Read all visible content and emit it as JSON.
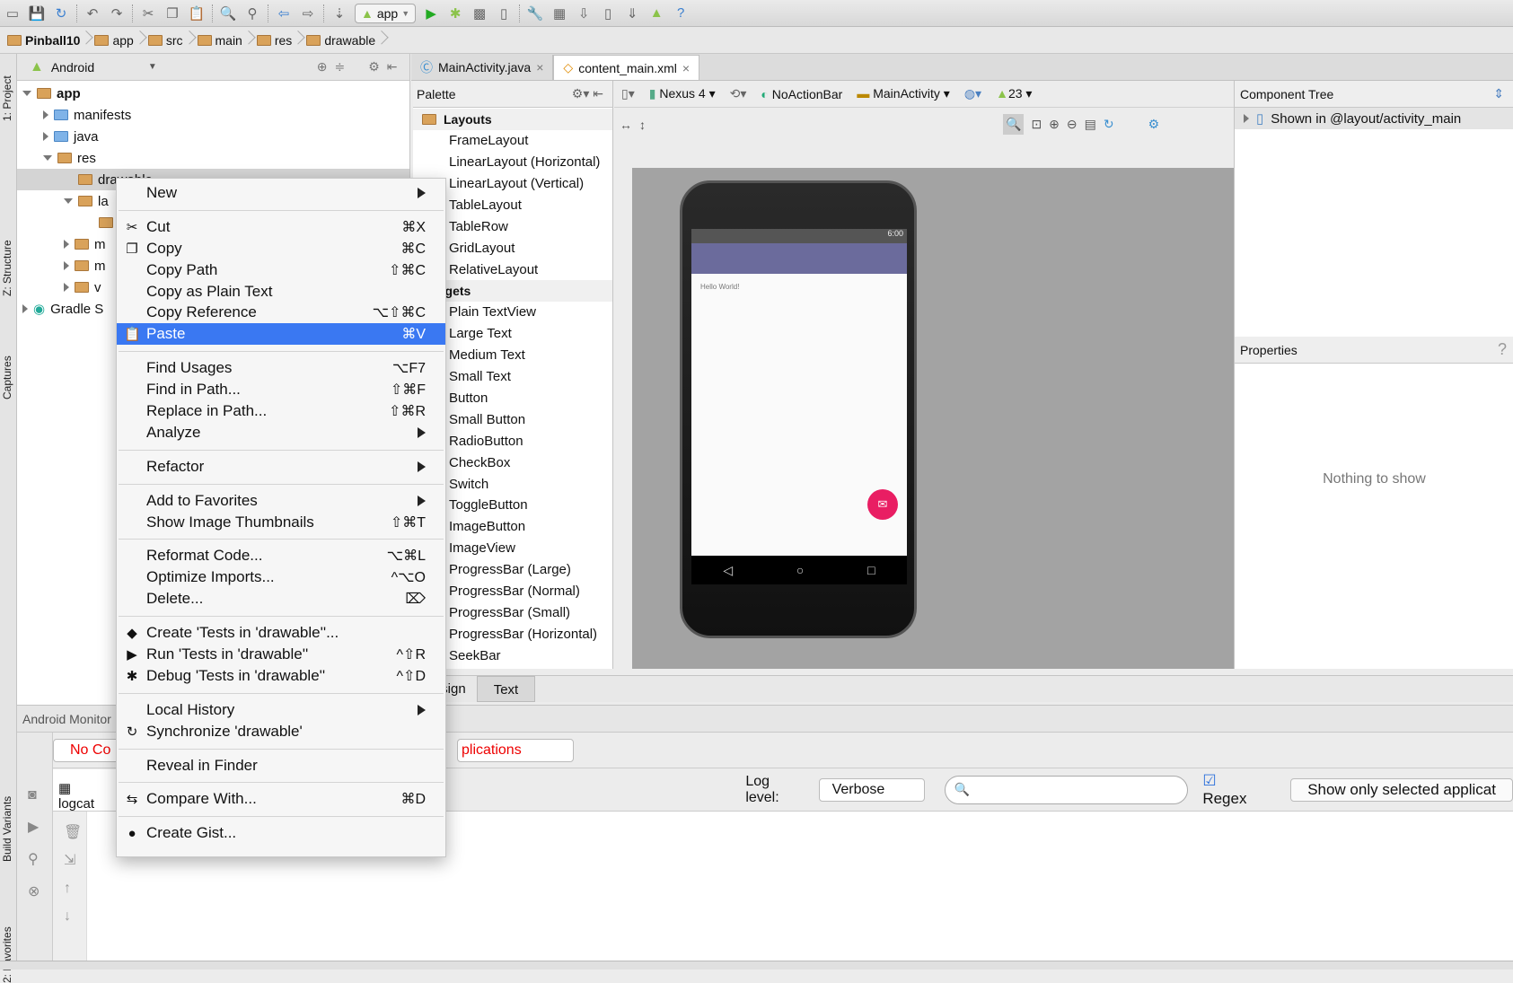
{
  "toolbar": {
    "run_config": "app",
    "icons": [
      "open-icon",
      "save-icon",
      "sync-icon",
      "undo-icon",
      "redo-icon",
      "cut-icon",
      "copy-icon",
      "paste-icon",
      "find-icon",
      "replace-icon",
      "back-icon",
      "forward-icon",
      "make-icon",
      "run-icon",
      "debug-icon",
      "attach-icon",
      "device-monitor-icon",
      "settings-icon",
      "project-structure-icon",
      "sdk-icon",
      "avd-icon",
      "gradle-sync-icon",
      "android-icon",
      "help-icon"
    ]
  },
  "breadcrumb": [
    "Pinball10",
    "app",
    "src",
    "main",
    "res",
    "drawable"
  ],
  "left_stripe": {
    "project": "1: Project",
    "structure": "Z: Structure",
    "captures": "Captures",
    "build_variants": "Build Variants",
    "favorites": "2: Favorites"
  },
  "project": {
    "view": "Android",
    "tree": [
      {
        "label": "app",
        "level": 0,
        "open": true,
        "bold": true
      },
      {
        "label": "manifests",
        "level": 1,
        "open": false
      },
      {
        "label": "java",
        "level": 1,
        "open": false
      },
      {
        "label": "res",
        "level": 1,
        "open": true
      },
      {
        "label": "drawable",
        "level": 2,
        "selected": true
      },
      {
        "label": "la",
        "level": 2,
        "open": true
      },
      {
        "label": "",
        "level": 3
      },
      {
        "label": "m",
        "level": 2,
        "open": false
      },
      {
        "label": "m",
        "level": 2,
        "open": false
      },
      {
        "label": "v",
        "level": 2,
        "open": false
      },
      {
        "label": "Gradle S",
        "level": 0,
        "open": false
      }
    ]
  },
  "editor_tabs": [
    {
      "label": "MainActivity.java",
      "active": false
    },
    {
      "label": "content_main.xml",
      "active": true
    }
  ],
  "palette": {
    "title": "Palette",
    "sections": [
      {
        "name": "Layouts",
        "items": [
          "FrameLayout",
          "LinearLayout (Horizontal)",
          "LinearLayout (Vertical)",
          "TableLayout",
          "TableRow",
          "GridLayout",
          "RelativeLayout"
        ]
      },
      {
        "name": "Widgets",
        "items": [
          "Plain TextView",
          "Large Text",
          "Medium Text",
          "Small Text",
          "Button",
          "Small Button",
          "RadioButton",
          "CheckBox",
          "Switch",
          "ToggleButton",
          "ImageButton",
          "ImageView",
          "ProgressBar (Large)",
          "ProgressBar (Normal)",
          "ProgressBar (Small)",
          "ProgressBar (Horizontal)",
          "SeekBar"
        ]
      }
    ]
  },
  "design_toolbar": {
    "device": "Nexus 4",
    "theme": "NoActionBar",
    "activity": "MainActivity",
    "api": "23"
  },
  "preview": {
    "time": "6:00",
    "hello": "Hello World!",
    "fab_color": "#e91e63",
    "appbar_color": "#6b6b9c"
  },
  "design_tabs": [
    "Design",
    "Text"
  ],
  "component_tree": {
    "title": "Component Tree",
    "item": "Shown in @layout/activity_main"
  },
  "properties": {
    "title": "Properties",
    "help": "?",
    "empty": "Nothing to show"
  },
  "monitor": {
    "title": "Android Monitor",
    "device": "No Co",
    "apps": "plications",
    "logcat_tab": "logcat",
    "log_level_label": "Log level:",
    "log_level": "Verbose",
    "search_placeholder": "",
    "regex": "Regex",
    "regex_checked": true,
    "show_only": "Show only selected applicat"
  },
  "context_menu": {
    "groups": [
      [
        {
          "label": "New",
          "submenu": true
        }
      ],
      [
        {
          "label": "Cut",
          "shortcut": "⌘X",
          "icon": "✂"
        },
        {
          "label": "Copy",
          "shortcut": "⌘C",
          "icon": "❐"
        },
        {
          "label": "Copy Path",
          "shortcut": "⇧⌘C"
        },
        {
          "label": "Copy as Plain Text"
        },
        {
          "label": "Copy Reference",
          "shortcut": "⌥⇧⌘C"
        },
        {
          "label": "Paste",
          "shortcut": "⌘V",
          "icon": "📋",
          "selected": true
        }
      ],
      [
        {
          "label": "Find Usages",
          "shortcut": "⌥F7"
        },
        {
          "label": "Find in Path...",
          "shortcut": "⇧⌘F"
        },
        {
          "label": "Replace in Path...",
          "shortcut": "⇧⌘R"
        },
        {
          "label": "Analyze",
          "submenu": true
        }
      ],
      [
        {
          "label": "Refactor",
          "submenu": true
        }
      ],
      [
        {
          "label": "Add to Favorites",
          "submenu": true
        },
        {
          "label": "Show Image Thumbnails",
          "shortcut": "⇧⌘T"
        }
      ],
      [
        {
          "label": "Reformat Code...",
          "shortcut": "⌥⌘L"
        },
        {
          "label": "Optimize Imports...",
          "shortcut": "^⌥O"
        },
        {
          "label": "Delete...",
          "shortcut": "⌦"
        }
      ],
      [
        {
          "label": "Create 'Tests in 'drawable''...",
          "icon": "◆"
        },
        {
          "label": "Run 'Tests in 'drawable''",
          "shortcut": "^⇧R",
          "icon": "▶"
        },
        {
          "label": "Debug 'Tests in 'drawable''",
          "shortcut": "^⇧D",
          "icon": "✱"
        }
      ],
      [
        {
          "label": "Local History",
          "submenu": true
        },
        {
          "label": "Synchronize 'drawable'",
          "icon": "↻"
        }
      ],
      [
        {
          "label": "Reveal in Finder"
        }
      ],
      [
        {
          "label": "Compare With...",
          "shortcut": "⌘D",
          "icon": "⇆"
        }
      ],
      [
        {
          "label": "Create Gist...",
          "icon": "●"
        }
      ]
    ]
  }
}
